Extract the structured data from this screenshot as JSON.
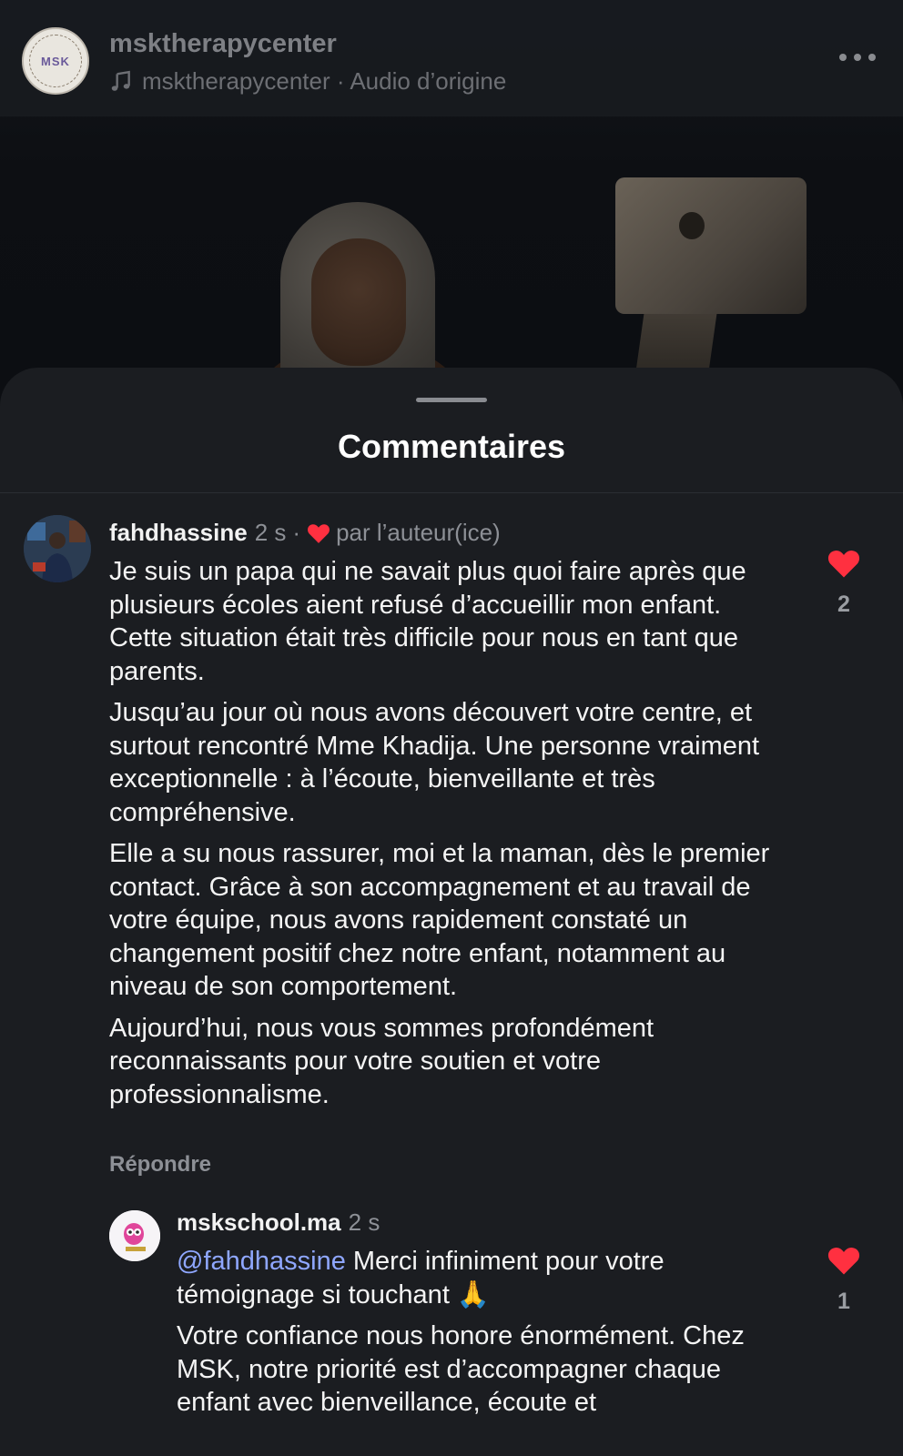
{
  "header": {
    "channel_name": "msktherapycenter",
    "audio_source": "msktherapycenter · Audio d’origine",
    "avatar_text": "MSK"
  },
  "sheet": {
    "title": "Commentaires"
  },
  "comments": [
    {
      "username": "fahdhassine",
      "time": "2 s",
      "separator": "·",
      "liked_by_author": "par l’auteur(ice)",
      "paragraphs": [
        "Je suis un papa qui ne savait plus quoi faire après que plusieurs écoles aient refusé d’accueillir mon enfant. Cette situation était très difficile pour nous en tant que parents.",
        "Jusqu’au jour où nous avons découvert votre centre, et surtout rencontré Mme Khadija. Une personne vraiment exceptionnelle : à l’écoute, bienveillante et très compréhensive.",
        "Elle a su nous rassurer, moi et la maman, dès le premier contact. Grâce à son accompagnement et au travail de votre équipe, nous avons rapidement constaté un changement positif chez notre enfant, notamment au niveau de son comportement.",
        "Aujourd’hui, nous vous sommes profondément reconnaissants pour votre soutien et votre professionnalisme."
      ],
      "reply_label": "Répondre",
      "like_count": "2"
    },
    {
      "username": "mskschool.ma",
      "time": "2 s",
      "mention": "@fahdhassine",
      "first_text": " Merci infiniment pour votre témoignage si touchant 🙏",
      "second_text": "Votre confiance nous honore énormément. Chez MSK, notre priorité est d’accompagner chaque enfant avec bienveillance, écoute et",
      "like_count": "1"
    }
  ],
  "colors": {
    "background": "#0d0f12",
    "sheet": "#1b1d21",
    "heart": "#ff3040",
    "mention": "#8fa7ff",
    "muted": "#8d9096"
  },
  "icons": [
    "music-note-icon",
    "more-options-icon",
    "heart-icon"
  ]
}
